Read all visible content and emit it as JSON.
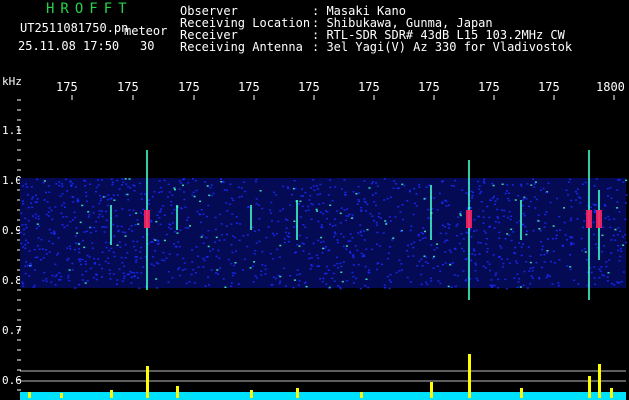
{
  "header": {
    "logo": "HROFFT",
    "filename": "UT2511081750.pn",
    "tag": "meteor",
    "datetime": "25.11.08 17:50",
    "duration": "30",
    "fields": [
      {
        "label": "Observer",
        "value": ": Masaki Kano"
      },
      {
        "label": "Receiving Location",
        "value": ": Shibukawa, Gunma, Japan"
      },
      {
        "label": "Receiver",
        "value": ": RTL-SDR SDR# 43dB L15 103.2MHz CW"
      },
      {
        "label": "Receiving Antenna",
        "value": ": 3el Yagi(V) Az 330 for Vladivostok"
      }
    ]
  },
  "time_axis": {
    "ticks": [
      "175",
      "175",
      "175",
      "175",
      "175",
      "175",
      "175",
      "175",
      "175",
      "1800"
    ]
  },
  "freq_axis": {
    "unit": "kHz",
    "ticks": [
      "1.1",
      "1.0",
      "0.9",
      "0.8",
      "0.7",
      "0.6"
    ]
  },
  "colors": {
    "background": "#000000",
    "noise": "#1a2cff",
    "signal": "#40ffd0",
    "echo": "#ff2060",
    "level": "#ffff00",
    "baseline": "#00e0ff"
  }
}
